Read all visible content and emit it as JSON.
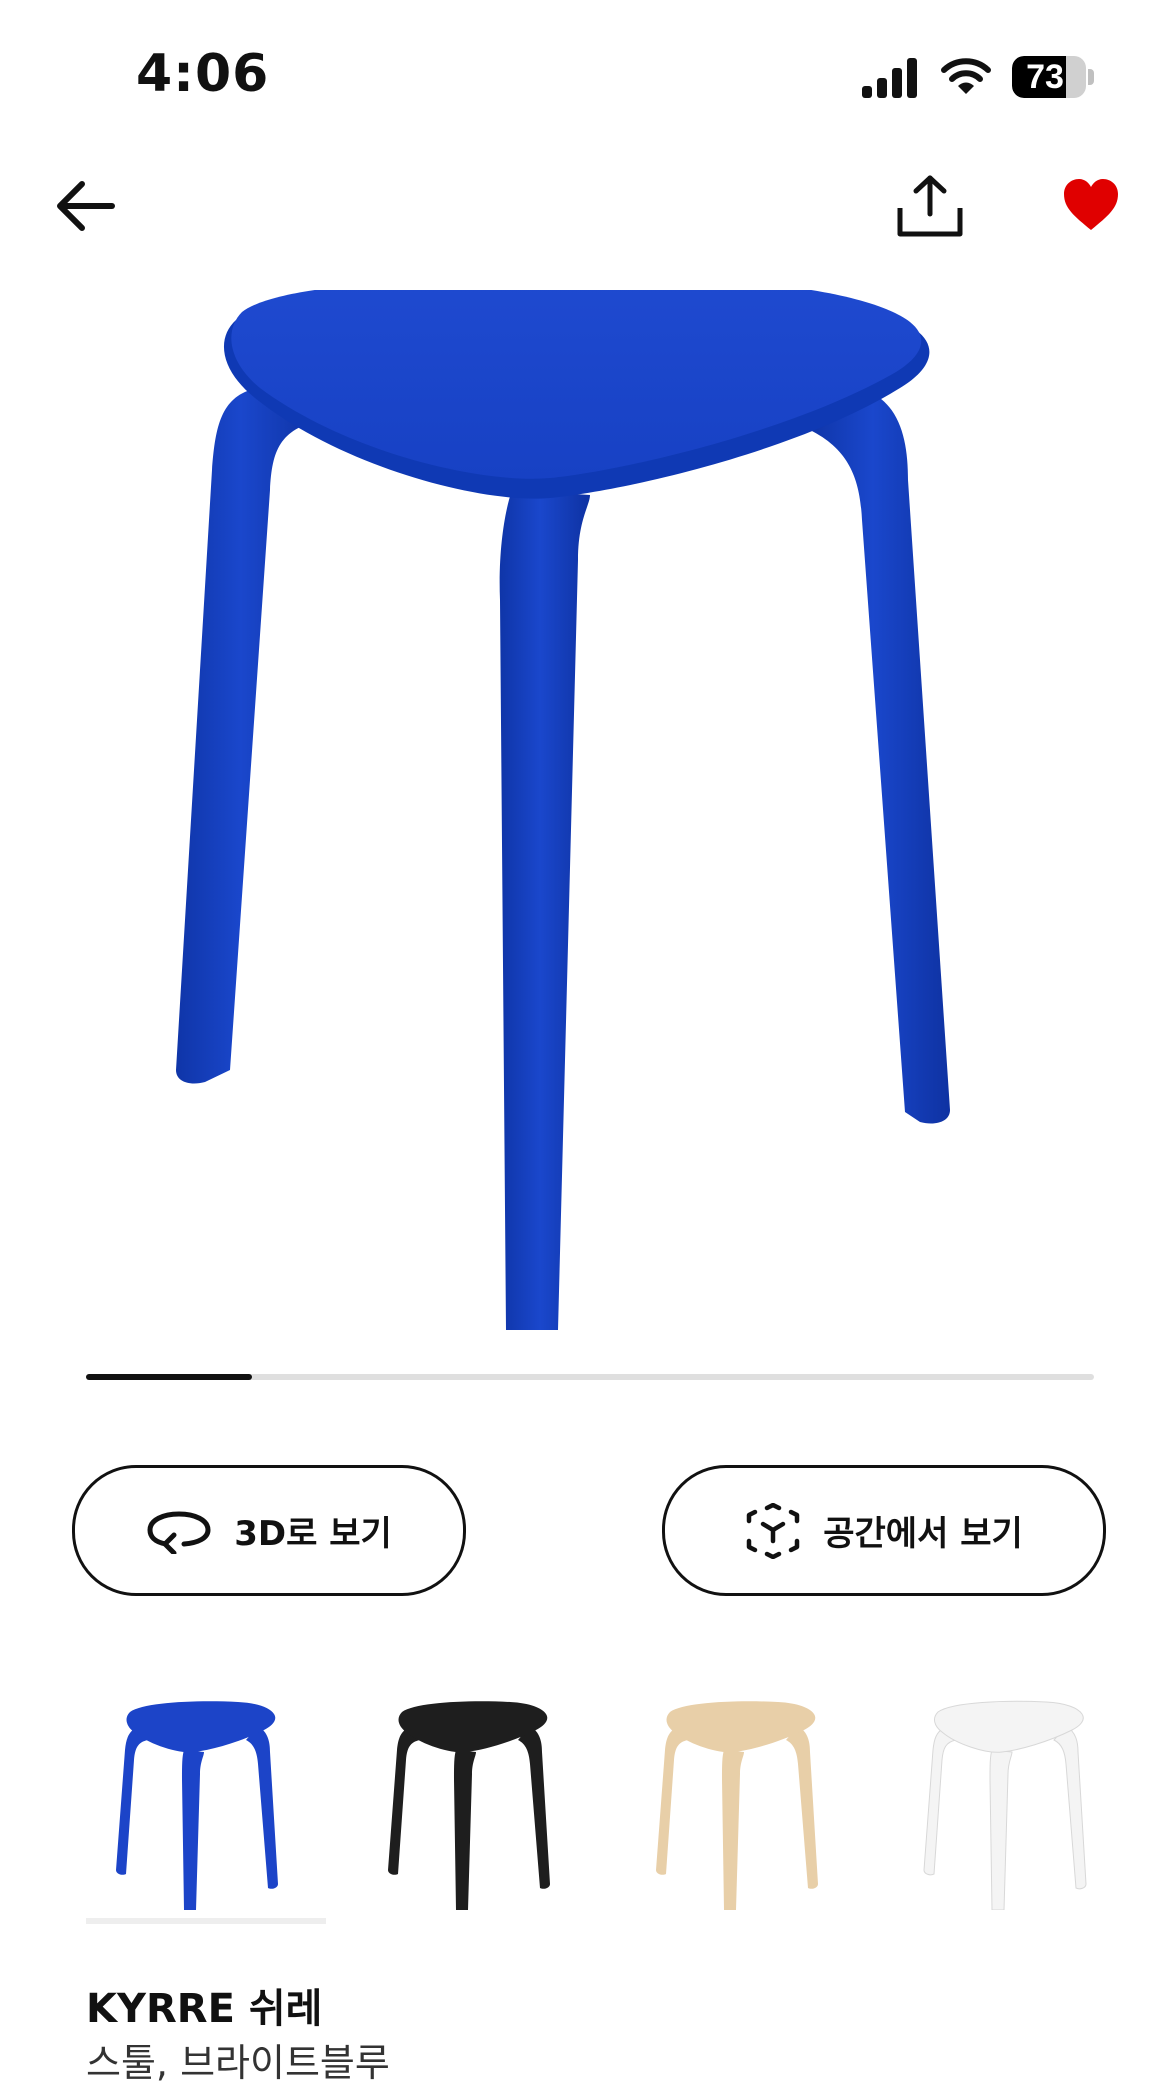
{
  "status_bar": {
    "time": "4:06",
    "battery_level": "73",
    "battery_fraction": 0.73
  },
  "header": {
    "back_icon": "arrow-left-icon",
    "share_icon": "share-upload-icon",
    "favorite_icon": "heart-filled-icon",
    "favorite_color": "#E00000"
  },
  "gallery": {
    "image_position_fraction": 0.165
  },
  "actions": {
    "view_3d_label": "3D로 보기",
    "view_3d_icon": "rotate-3d-icon",
    "view_in_space_label": "공간에서 보기",
    "view_in_space_icon": "ar-cube-icon"
  },
  "variants": [
    {
      "name": "blue",
      "color": "#1C44C8",
      "selected": true
    },
    {
      "name": "black",
      "color": "#1E1E1E",
      "selected": false
    },
    {
      "name": "birch",
      "color": "#E8CFA8",
      "selected": false
    },
    {
      "name": "white",
      "color": "#F4F4F4",
      "selected": false
    }
  ],
  "product": {
    "name": "KYRRE 쉬레",
    "description": "스툴, 브라이트블루"
  },
  "colors": {
    "product_blue": "#1A45C9",
    "product_blue_dark": "#0F35A8"
  }
}
